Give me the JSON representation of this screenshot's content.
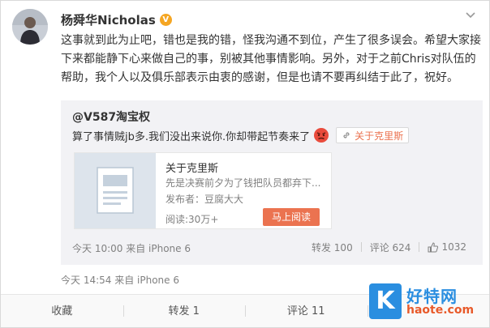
{
  "post": {
    "author": "杨舜华Nicholas",
    "verified_badge": "V",
    "text": "这事就到此为止吧，错也是我的错，怪我沟通不到位，产生了很多误会。希望大家接下来都能静下心来做自己的事，别被其他事情影响。另外，对于之前Chris对队伍的帮助，我个人以及俱乐部表示由衷的感谢，但是也请不要再纠结于此了，祝好。",
    "time": "今天 14:54 来自 iPhone 6"
  },
  "repost": {
    "author": "@V587淘宝权",
    "text": "算了事情贼jb多.我们没出来说你.你却带起节奏来了",
    "emoji_icon": "angry-face-icon",
    "topic_link": "关于克里斯",
    "article": {
      "title": "关于克里斯",
      "desc": "先是决赛前夕为了钱把队员都弃下...",
      "publisher": "发布者：豆腐大大",
      "reads": "阅读:30万+",
      "read_button": "马上阅读"
    },
    "time": "今天 10:00 来自 iPhone 6",
    "reposts": "转发 100",
    "comments": "评论 624",
    "likes": "1032"
  },
  "actions": {
    "favorite": "收藏",
    "repost": "转发 1",
    "comment": "评论 11",
    "like": ""
  },
  "watermark": {
    "cn": "好特网",
    "url": "haote.com"
  },
  "colors": {
    "accent": "#eb7350",
    "badge": "#f5a623",
    "watermark_blue": "#2a8ee0"
  }
}
